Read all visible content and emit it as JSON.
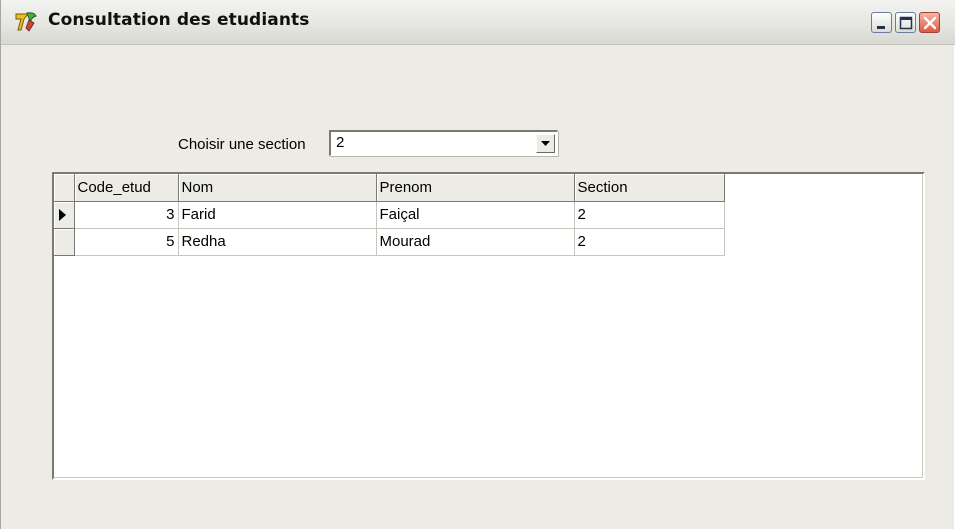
{
  "window": {
    "title": "Consultation des etudiants",
    "buttons": [
      "minimize",
      "maximize",
      "close"
    ]
  },
  "filter": {
    "label": "Choisir une section",
    "selected": "2"
  },
  "grid": {
    "columns": [
      "Code_etud",
      "Nom",
      "Prenom",
      "Section"
    ],
    "rows": [
      {
        "code": "3",
        "nom": "Farid",
        "prenom": "Faiçal",
        "section": "2",
        "current": true
      },
      {
        "code": "5",
        "nom": "Redha",
        "prenom": "Mourad",
        "section": "2",
        "current": false
      }
    ]
  },
  "colors": {
    "window_bg": "#ecebe5",
    "close_button": "#e0583f"
  }
}
